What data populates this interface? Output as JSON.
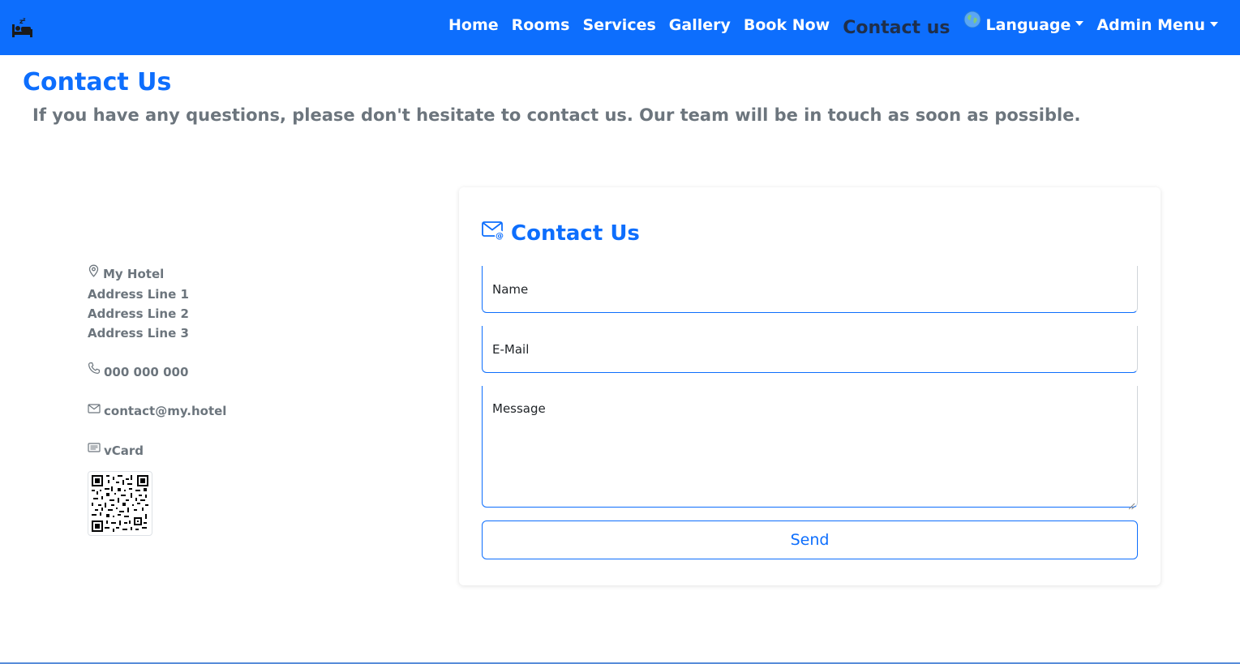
{
  "nav": {
    "brand_icon": "bed-icon",
    "items": [
      {
        "label": "Home"
      },
      {
        "label": "Rooms"
      },
      {
        "label": "Services"
      },
      {
        "label": "Gallery"
      },
      {
        "label": "Book Now"
      },
      {
        "label": "Contact us",
        "active": true
      }
    ],
    "language_label": "Language",
    "admin_label": "Admin Menu"
  },
  "header": {
    "title": "Contact Us",
    "lead": "If you have any questions, please don't hesitate to contact us. Our team will be in touch as soon as possible."
  },
  "address": {
    "name": "My Hotel",
    "lines": [
      "Address Line 1",
      "Address Line 2",
      "Address Line 3"
    ],
    "phone": "000 000 000",
    "email": "contact@my.hotel",
    "vcard_label": "vCard"
  },
  "form": {
    "title": "Contact Us",
    "name_placeholder": "Name",
    "email_placeholder": "E-Mail",
    "message_placeholder": "Message",
    "send_label": "Send"
  },
  "colors": {
    "primary": "#0d6efd",
    "muted_text": "#6c757d",
    "active_nav": "#1f2f4a"
  }
}
